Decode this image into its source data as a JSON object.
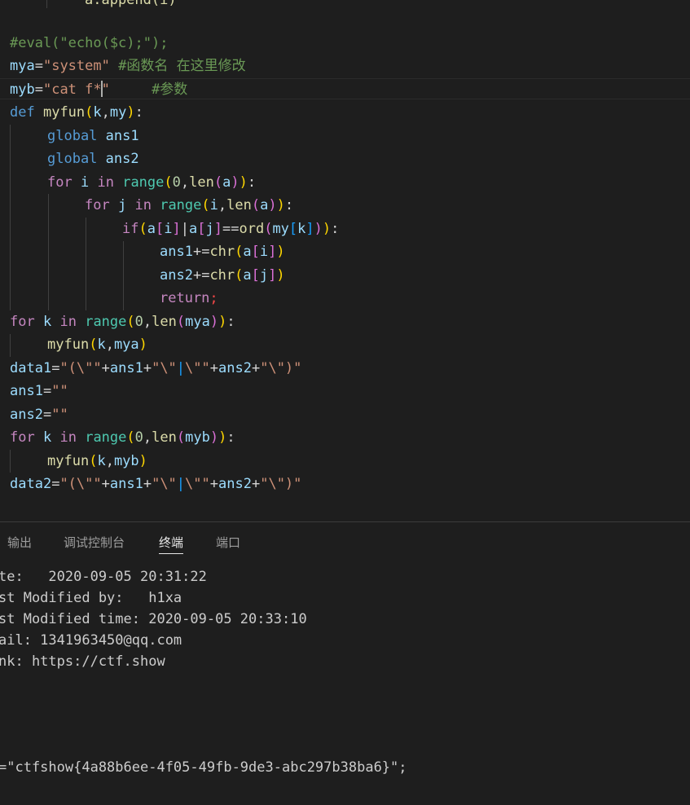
{
  "editor": {
    "partial_top": "a.append(i)",
    "comment_eval": "#eval(\"echo($c);\");",
    "mya_var": "mya",
    "mya_value": "\"system\"",
    "mya_comment": "#函数名 在这里修改",
    "myb_var": "myb",
    "myb_value_a": "\"cat f*",
    "myb_value_b": "\"",
    "myb_comment": "#参数",
    "def_kw": "def",
    "fn_name": "myfun",
    "param_k": "k",
    "param_my": "my",
    "global_kw": "global",
    "ans1": "ans1",
    "ans2": "ans2",
    "for_kw": "for",
    "in_kw": "in",
    "if_kw": "if",
    "return_kw": "return",
    "range_fn": "range",
    "len_fn": "len",
    "ord_fn": "ord",
    "chr_fn": "chr",
    "var_i": "i",
    "var_j": "j",
    "var_a": "a",
    "num_zero": "0",
    "data1": "data1",
    "data2": "data2",
    "str_open": "\"(\\\"\"",
    "str_mid_a": "\"\\\"",
    "str_mid_pipe": "|",
    "str_mid_b": "\\\"\"",
    "str_close": "\"\\\")\"",
    "empty_str": "\"\""
  },
  "panel": {
    "tabs": [
      {
        "label": "输出",
        "active": false
      },
      {
        "label": "调试控制台",
        "active": false
      },
      {
        "label": "终端",
        "active": true
      },
      {
        "label": "端口",
        "active": false
      }
    ]
  },
  "terminal": {
    "lines": [
      "te:   2020-09-05 20:31:22",
      "st Modified by:   h1xa",
      "st Modified time: 2020-09-05 20:33:10",
      "ail: 1341963450@qq.com",
      "nk: https://ctf.show"
    ],
    "flag_line": "=\"ctfshow{4a88b6ee-4f05-49fb-9de3-abc297b38ba6}\";"
  },
  "colors": {
    "background": "#1e1e1e",
    "comment": "#6a9955",
    "keyword": "#569cd6",
    "control": "#c586c0",
    "function": "#dcdcaa",
    "variable": "#9cdcfe",
    "string": "#ce9178"
  }
}
